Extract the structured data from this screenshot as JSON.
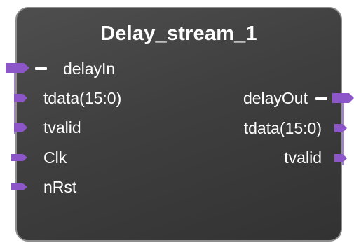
{
  "block": {
    "title": "Delay_stream_1",
    "colors": {
      "body": "#3f3f3f",
      "border": "#8e8e8e",
      "pin": "#8c55c8",
      "bus_bar": "#a084c9",
      "text": "#ffffff"
    }
  },
  "inputs": {
    "bus": {
      "label": "delayIn"
    },
    "bus_signals": [
      {
        "label": "tdata(15:0)"
      },
      {
        "label": "tvalid"
      }
    ],
    "signals": [
      {
        "label": "Clk"
      },
      {
        "label": "nRst"
      }
    ]
  },
  "outputs": {
    "bus": {
      "label": "delayOut"
    },
    "bus_signals": [
      {
        "label": "tdata(15:0)"
      },
      {
        "label": "tvalid"
      }
    ]
  }
}
